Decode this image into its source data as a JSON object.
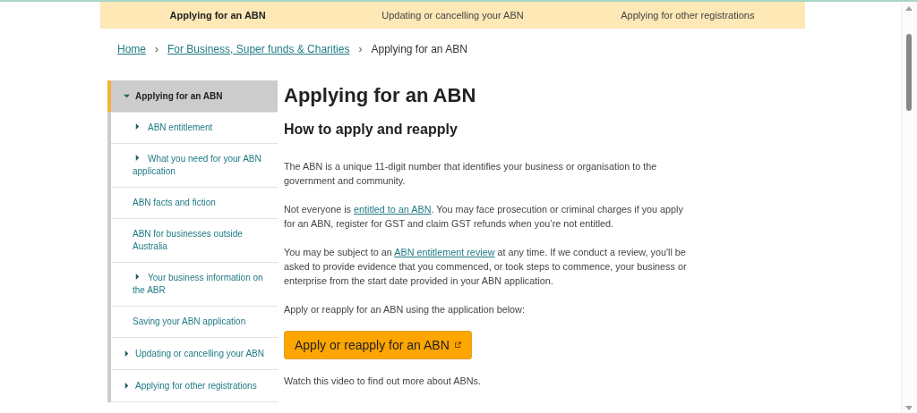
{
  "top_tabs": [
    {
      "label": "Applying for an ABN",
      "selected": true
    },
    {
      "label": "Updating or cancelling your ABN",
      "selected": false
    },
    {
      "label": "Applying for other registrations",
      "selected": false
    }
  ],
  "breadcrumb": {
    "separator": "›",
    "items": [
      {
        "label": "Home",
        "kind": "link"
      },
      {
        "label": "For Business, Super funds & Charities",
        "kind": "link"
      },
      {
        "label": "Applying for an ABN",
        "kind": "current"
      }
    ]
  },
  "sidebar": {
    "items": [
      {
        "label": "Applying for an ABN",
        "kind": "folder",
        "selected": true,
        "expanded": true,
        "children": [
          {
            "label": "ABN entitlement",
            "kind": "folder",
            "selected": false,
            "expanded": false
          },
          {
            "label": "What you need for your ABN application",
            "kind": "folder",
            "selected": false,
            "expanded": false
          },
          {
            "label": "ABN facts and fiction",
            "kind": "page",
            "selected": false
          },
          {
            "label": "ABN for businesses outside Australia",
            "kind": "page",
            "selected": false
          },
          {
            "label": "Your business information on the ABR",
            "kind": "folder",
            "selected": false,
            "expanded": false
          },
          {
            "label": "Saving your ABN application",
            "kind": "page",
            "selected": false
          }
        ]
      },
      {
        "label": "Updating or cancelling your ABN",
        "kind": "folder",
        "selected": false,
        "expanded": false
      },
      {
        "label": "Applying for other registrations",
        "kind": "folder",
        "selected": false,
        "expanded": false
      }
    ]
  },
  "main": {
    "title": "Applying for an ABN",
    "subtitle": "How to apply and reapply",
    "paragraphs": [
      [
        {
          "text": "The ABN is a unique 11-digit number that identifies your business or organisation to the government and community."
        }
      ],
      [
        {
          "text": "Not everyone is "
        },
        {
          "link": "entitled to an ABN"
        },
        {
          "text": ". You may face prosecution or criminal charges if you apply for an ABN, register for GST and claim GST refunds when you’re not entitled."
        }
      ],
      [
        {
          "text": "You may be subject to an "
        },
        {
          "link": "ABN entitlement review"
        },
        {
          "text": " at any time. If we conduct a review, you'll be asked to provide evidence that you commenced, or took steps to commence, your business or enterprise from the start date provided in your ABN application."
        }
      ],
      [
        {
          "text": "Apply or reapply for an ABN using the application below:"
        }
      ]
    ],
    "button": "Apply or reapply for an ABN",
    "footer_text": "Watch this video to find out more about ABNs."
  }
}
